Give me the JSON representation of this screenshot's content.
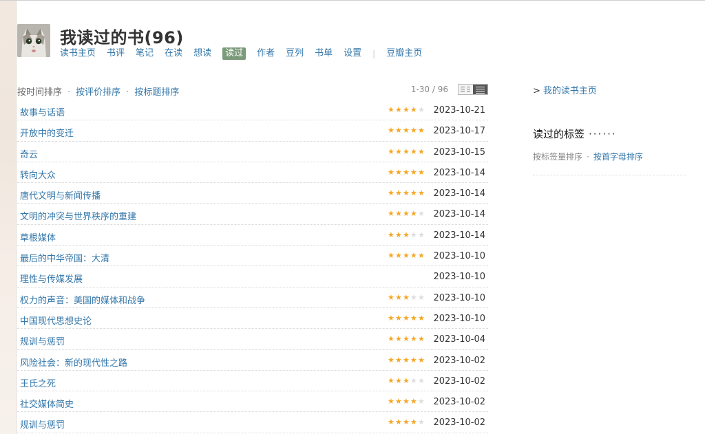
{
  "header": {
    "title": "我读过的书(96)",
    "nav": [
      {
        "label": "读书主页",
        "active": false
      },
      {
        "label": "书评",
        "active": false
      },
      {
        "label": "笔记",
        "active": false
      },
      {
        "label": "在读",
        "active": false
      },
      {
        "label": "想读",
        "active": false
      },
      {
        "label": "读过",
        "active": true
      },
      {
        "label": "作者",
        "active": false
      },
      {
        "label": "豆列",
        "active": false
      },
      {
        "label": "书单",
        "active": false
      },
      {
        "label": "设置",
        "active": false
      }
    ],
    "nav_separator": "|",
    "nav_extra": "豆瓣主页"
  },
  "sortbar": {
    "current": "按时间排序",
    "dot": "·",
    "by_rating": "按评价排序",
    "by_title": "按标题排序",
    "pager": "1-30 / 96"
  },
  "books": [
    {
      "title": "故事与话语",
      "rating": 4,
      "date": "2023-10-21"
    },
    {
      "title": "开放中的变迁",
      "rating": 5,
      "date": "2023-10-17"
    },
    {
      "title": "奇云",
      "rating": 5,
      "date": "2023-10-15"
    },
    {
      "title": "转向大众",
      "rating": 5,
      "date": "2023-10-14"
    },
    {
      "title": "唐代文明与新闻传播",
      "rating": 5,
      "date": "2023-10-14"
    },
    {
      "title": "文明的冲突与世界秩序的重建",
      "rating": 4,
      "date": "2023-10-14"
    },
    {
      "title": "草根媒体",
      "rating": 3,
      "date": "2023-10-14"
    },
    {
      "title": "最后的中华帝国：大清",
      "rating": 5,
      "date": "2023-10-10"
    },
    {
      "title": "理性与传媒发展",
      "rating": 0,
      "date": "2023-10-10"
    },
    {
      "title": "权力的声音：美国的媒体和战争",
      "rating": 3,
      "date": "2023-10-10"
    },
    {
      "title": "中国现代思想史论",
      "rating": 5,
      "date": "2023-10-10"
    },
    {
      "title": "规训与惩罚",
      "rating": 5,
      "date": "2023-10-04"
    },
    {
      "title": "风险社会：新的现代性之路",
      "rating": 5,
      "date": "2023-10-02"
    },
    {
      "title": "王氏之死",
      "rating": 3,
      "date": "2023-10-02"
    },
    {
      "title": "社交媒体简史",
      "rating": 4,
      "date": "2023-10-02"
    },
    {
      "title": "规训与惩罚",
      "rating": 4,
      "date": "2023-10-02"
    }
  ],
  "sidebar": {
    "arrow": ">",
    "my_home": "我的读书主页",
    "tags_title": "读过的标签",
    "tags_dots": "······",
    "tags_sort_by_count": "按标签量排序",
    "dot": "·",
    "tags_sort_alpha": "按首字母排序"
  },
  "colors": {
    "link": "#3377aa",
    "star_on": "#f5a623",
    "star_off": "#dddddd",
    "active_tab": "#7b9a7a"
  }
}
